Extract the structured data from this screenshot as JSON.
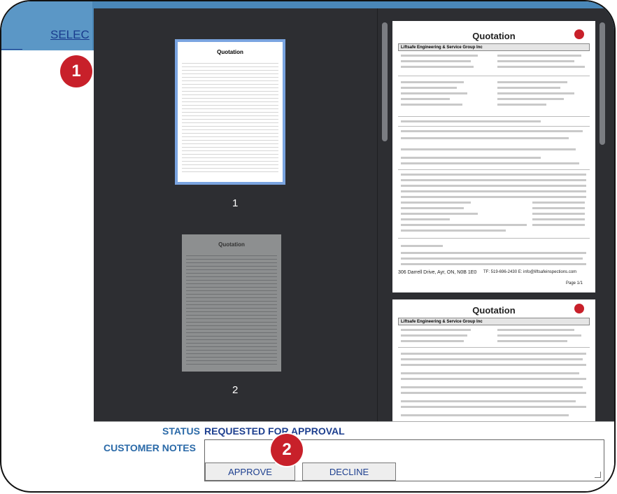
{
  "header": {
    "select_link": "SELEC"
  },
  "markers": {
    "one": "1",
    "two": "2"
  },
  "viewer": {
    "thumbnails": [
      {
        "number": "1"
      },
      {
        "number": "2"
      }
    ],
    "page1": {
      "title": "Quotation",
      "company": "Liftsafe Engineering & Service Group Inc",
      "footer_left": "306 Darrell Drive, Ayr, ON, N0B 1E0",
      "footer_right": "TF: 519-696-2430 E: info@liftsafeinspections.com",
      "page_label": "Page 1/1"
    },
    "page2": {
      "title": "Quotation",
      "company": "Liftsafe Engineering & Service Group Inc"
    }
  },
  "panel": {
    "status_label": "STATUS",
    "status_value": "REQUESTED FOR APPROVAL",
    "notes_label": "CUSTOMER NOTES",
    "notes_value": "",
    "approve": "APPROVE",
    "decline": "DECLINE"
  },
  "colors": {
    "accent": "#2b6aa8",
    "marker": "#c8202a",
    "viewer_bg": "#2d2e32"
  }
}
